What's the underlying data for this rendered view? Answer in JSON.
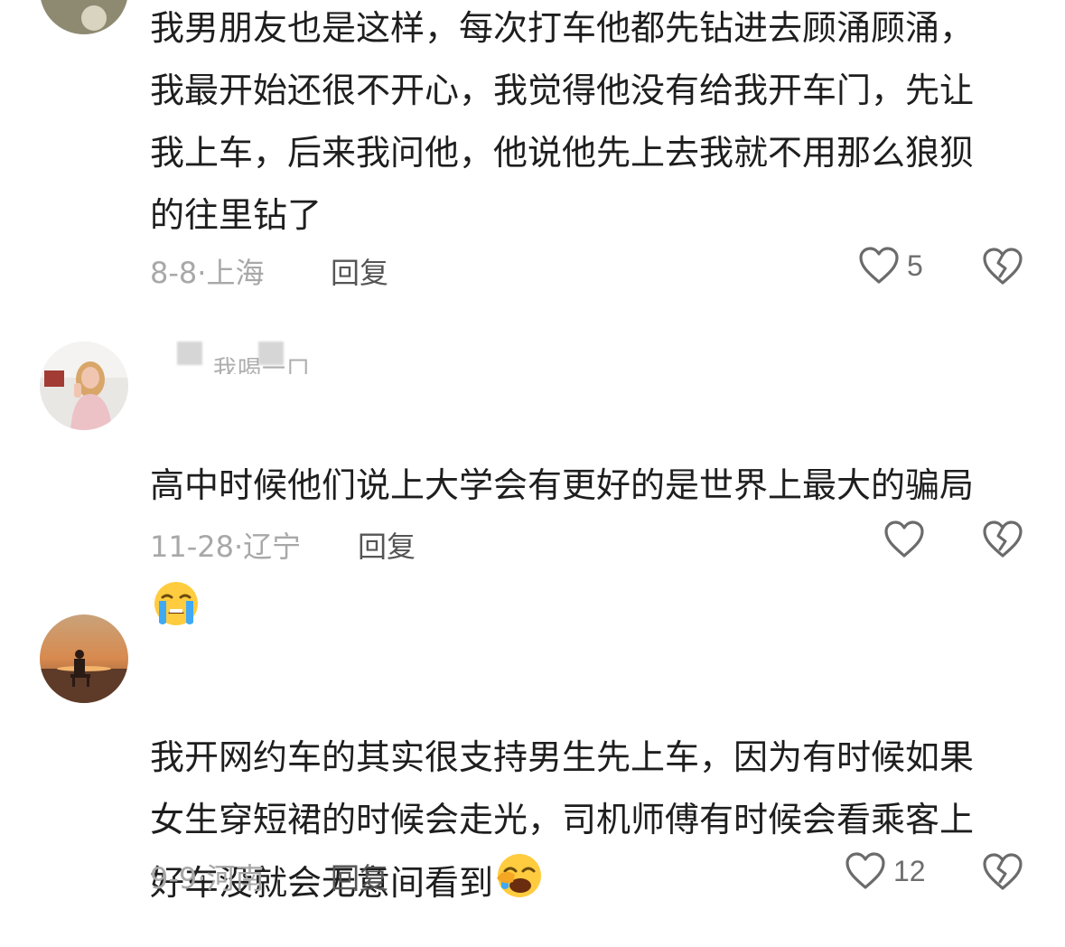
{
  "comments": [
    {
      "username": "",
      "text": "我男朋友也是这样，每次打车他都先钻进去顾涌顾涌，\n我最开始还很不开心，我觉得他没有给我开车门，先让\n我上车，后来我问他，他说他先上去我就不用那么狼狈\n的往里钻了",
      "date": "8-8",
      "region": "上海",
      "reply_label": "回复",
      "likes": "5",
      "emoji": ""
    },
    {
      "username": "我喝一口",
      "text": "高中时候他们说上大学会有更好的是世界上最大的骗局",
      "date": "11-28",
      "region": "辽宁",
      "reply_label": "回复",
      "likes": "",
      "emoji": "loudly-crying-face-icon"
    },
    {
      "username": "",
      "text": "我开网约车的其实很支持男生先上车，因为有时候如果\n女生穿短裙的时候会走光，司机师傅有时候会看乘客上\n好车没就会无意间看到",
      "date": "9-9",
      "region": "河南",
      "reply_label": "回复",
      "likes": "12",
      "emoji": "face-with-hand-over-mouth-icon"
    }
  ],
  "icons": {
    "like": "heart-outline-icon",
    "dislike": "broken-heart-icon"
  },
  "colors": {
    "meta": "#a8a8a8",
    "text": "#1e1e1e",
    "icon": "#6b6b6b"
  }
}
